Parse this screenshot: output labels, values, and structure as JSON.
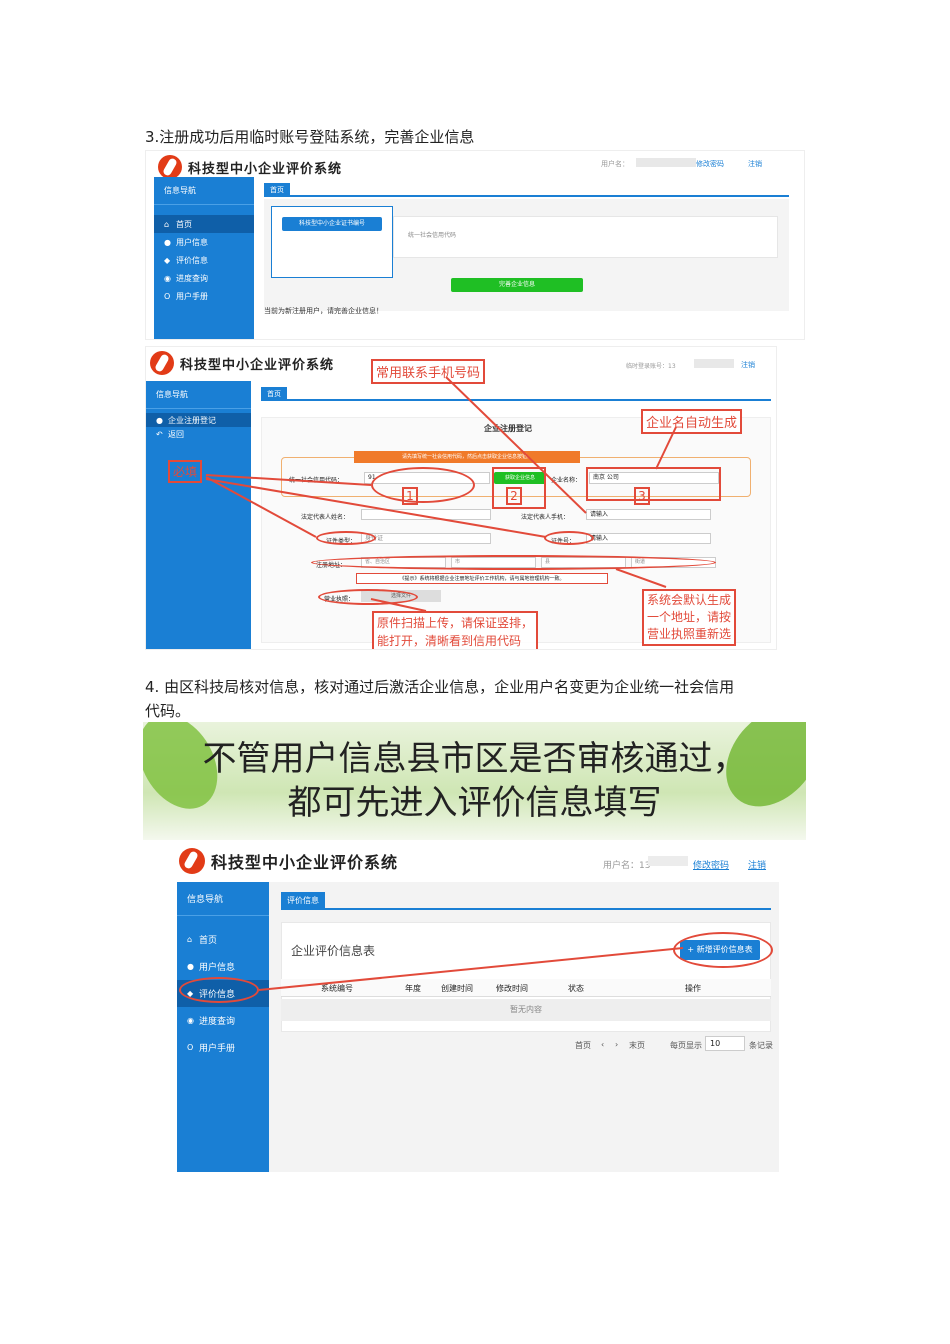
{
  "captions": {
    "step3": "3.注册成功后用临时账号登陆系统，完善企业信息",
    "step4_line1": "4.  由区科技局核对信息，核对通过后激活企业信息，企业用户名变更为企业统一社会信用",
    "step4_line2": "代码。"
  },
  "app_title": "科技型中小企业评价系统",
  "shot1": {
    "user_label": "用户名：",
    "change_password": "修改密码",
    "logout": "注销",
    "nav_title": "信息导航",
    "nav_items": [
      "首页",
      "用户信息",
      "评价信息",
      "进度查询",
      "用户手册"
    ],
    "tab": "首页",
    "cert_button": "科技型中小企业证书编号",
    "credit_code_label": "统一社会信用代码",
    "complete_button": "完善企业信息",
    "notice": "当前为新注册用户，请完善企业信息！"
  },
  "shot2": {
    "temp_account": "临时登录账号：13",
    "logout": "注销",
    "nav_title": "信息导航",
    "nav_items": [
      "企业注册登记",
      "返回"
    ],
    "tab": "首页",
    "form_title": "企业注册登记",
    "warning": "请先填写统一社会信用代码，然后点击获取企业信息按钮。",
    "credit_code_label": "统一社会信用代码：",
    "credit_code_value": "91",
    "fetch_button": "获取企业信息",
    "company_name_label": "企业名称：",
    "company_name_value": "南京                    公司",
    "legal_name_label": "法定代表人姓名：",
    "legal_phone_label": "法定代表人手机：",
    "legal_phone_value": "请输入",
    "legal_type_label": "证件类型：",
    "legal_type_value": "身份证",
    "id_number_label": "证件号：",
    "id_number_value": "请输入",
    "address_label": "注册地址：",
    "address_values": [
      "省、自治区",
      "市",
      "县",
      "街道"
    ],
    "hint": "《提示》系统将根据企业注册地址评价工作机构，请与属地管理机构一致。",
    "license_label": "营业执照：",
    "license_button": "选择文件",
    "callouts": {
      "phone": "常用联系手机号码",
      "auto_name": "企业名自动生成",
      "fill": "必填",
      "scan_line1": "原件扫描上传，请保证竖排，",
      "scan_line2": "能打开，清晰看到信用代码",
      "default_line1": "系统会默认生成",
      "default_line2": "一个地址，请按",
      "default_line3": "营业执照重新选"
    },
    "step_numbers": [
      "1",
      "2",
      "3"
    ]
  },
  "shot3": {
    "banner_line1": "不管用户信息县市区是否审核通过，",
    "banner_line2": "都可先进入评价信息填写",
    "user_label": "用户名：13",
    "change_password": "修改密码",
    "logout": "注销",
    "nav_title": "信息导航",
    "nav_items": [
      "首页",
      "用户信息",
      "评价信息",
      "进度查询",
      "用户手册"
    ],
    "tab": "评价信息",
    "table_title": "企业评价信息表",
    "add_button": "新增评价信息表",
    "columns": [
      "系统编号",
      "年度",
      "创建时间",
      "修改时间",
      "状态",
      "操作"
    ],
    "empty": "暂无内容",
    "pager": [
      "首页",
      "‹",
      "›",
      "末页"
    ],
    "per_page_label": "每页显示",
    "per_page_value": "10",
    "per_page_suffix": "条记录"
  },
  "colors": {
    "sidebar": "#1a7fd4",
    "accent_red": "#e24a3a",
    "green": "#1fbf24"
  }
}
